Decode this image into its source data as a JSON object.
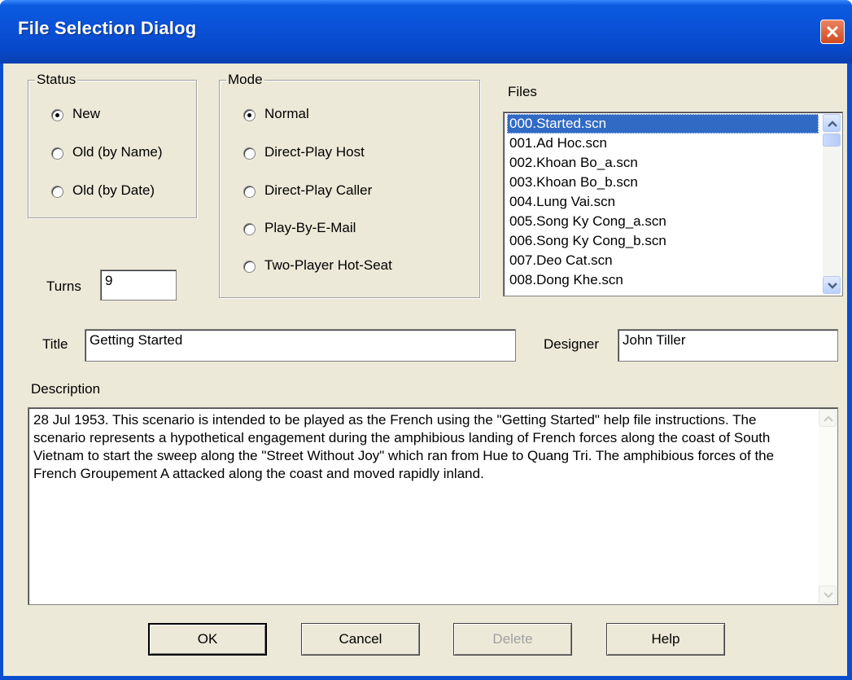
{
  "window": {
    "title": "File Selection Dialog"
  },
  "status": {
    "caption": "Status",
    "options": [
      {
        "label": "New",
        "selected": true
      },
      {
        "label": "Old (by Name)",
        "selected": false
      },
      {
        "label": "Old (by Date)",
        "selected": false
      }
    ]
  },
  "mode": {
    "caption": "Mode",
    "options": [
      {
        "label": "Normal",
        "selected": true
      },
      {
        "label": "Direct-Play Host",
        "selected": false
      },
      {
        "label": "Direct-Play Caller",
        "selected": false
      },
      {
        "label": "Play-By-E-Mail",
        "selected": false
      },
      {
        "label": "Two-Player Hot-Seat",
        "selected": false
      }
    ]
  },
  "turns": {
    "label": "Turns",
    "value": "9"
  },
  "files": {
    "label": "Files",
    "items": [
      "000.Started.scn",
      "001.Ad Hoc.scn",
      "002.Khoan Bo_a.scn",
      "003.Khoan Bo_b.scn",
      "004.Lung Vai.scn",
      "005.Song Ky Cong_a.scn",
      "006.Song Ky Cong_b.scn",
      "007.Deo Cat.scn",
      "008.Dong Khe.scn"
    ],
    "selected_index": 0
  },
  "title_field": {
    "label": "Title",
    "value": "Getting Started"
  },
  "designer_field": {
    "label": "Designer",
    "value": "John Tiller"
  },
  "description": {
    "label": "Description",
    "text": "28 Jul 1953.  This scenario is intended to be played as the French using the \"Getting Started\" help file instructions.  The scenario represents a hypothetical engagement during the amphibious landing of French forces along the coast of South Vietnam to start the sweep along the \"Street Without Joy\" which ran from Hue to Quang Tri.  The amphibious forces of the French Groupement A attacked along the coast and moved rapidly inland."
  },
  "buttons": {
    "ok": "OK",
    "cancel": "Cancel",
    "delete": "Delete",
    "help": "Help"
  },
  "colors": {
    "titlebar": "#0a52d8",
    "face": "#ece9d8",
    "selection": "#316ac5",
    "close": "#d24a1e"
  }
}
